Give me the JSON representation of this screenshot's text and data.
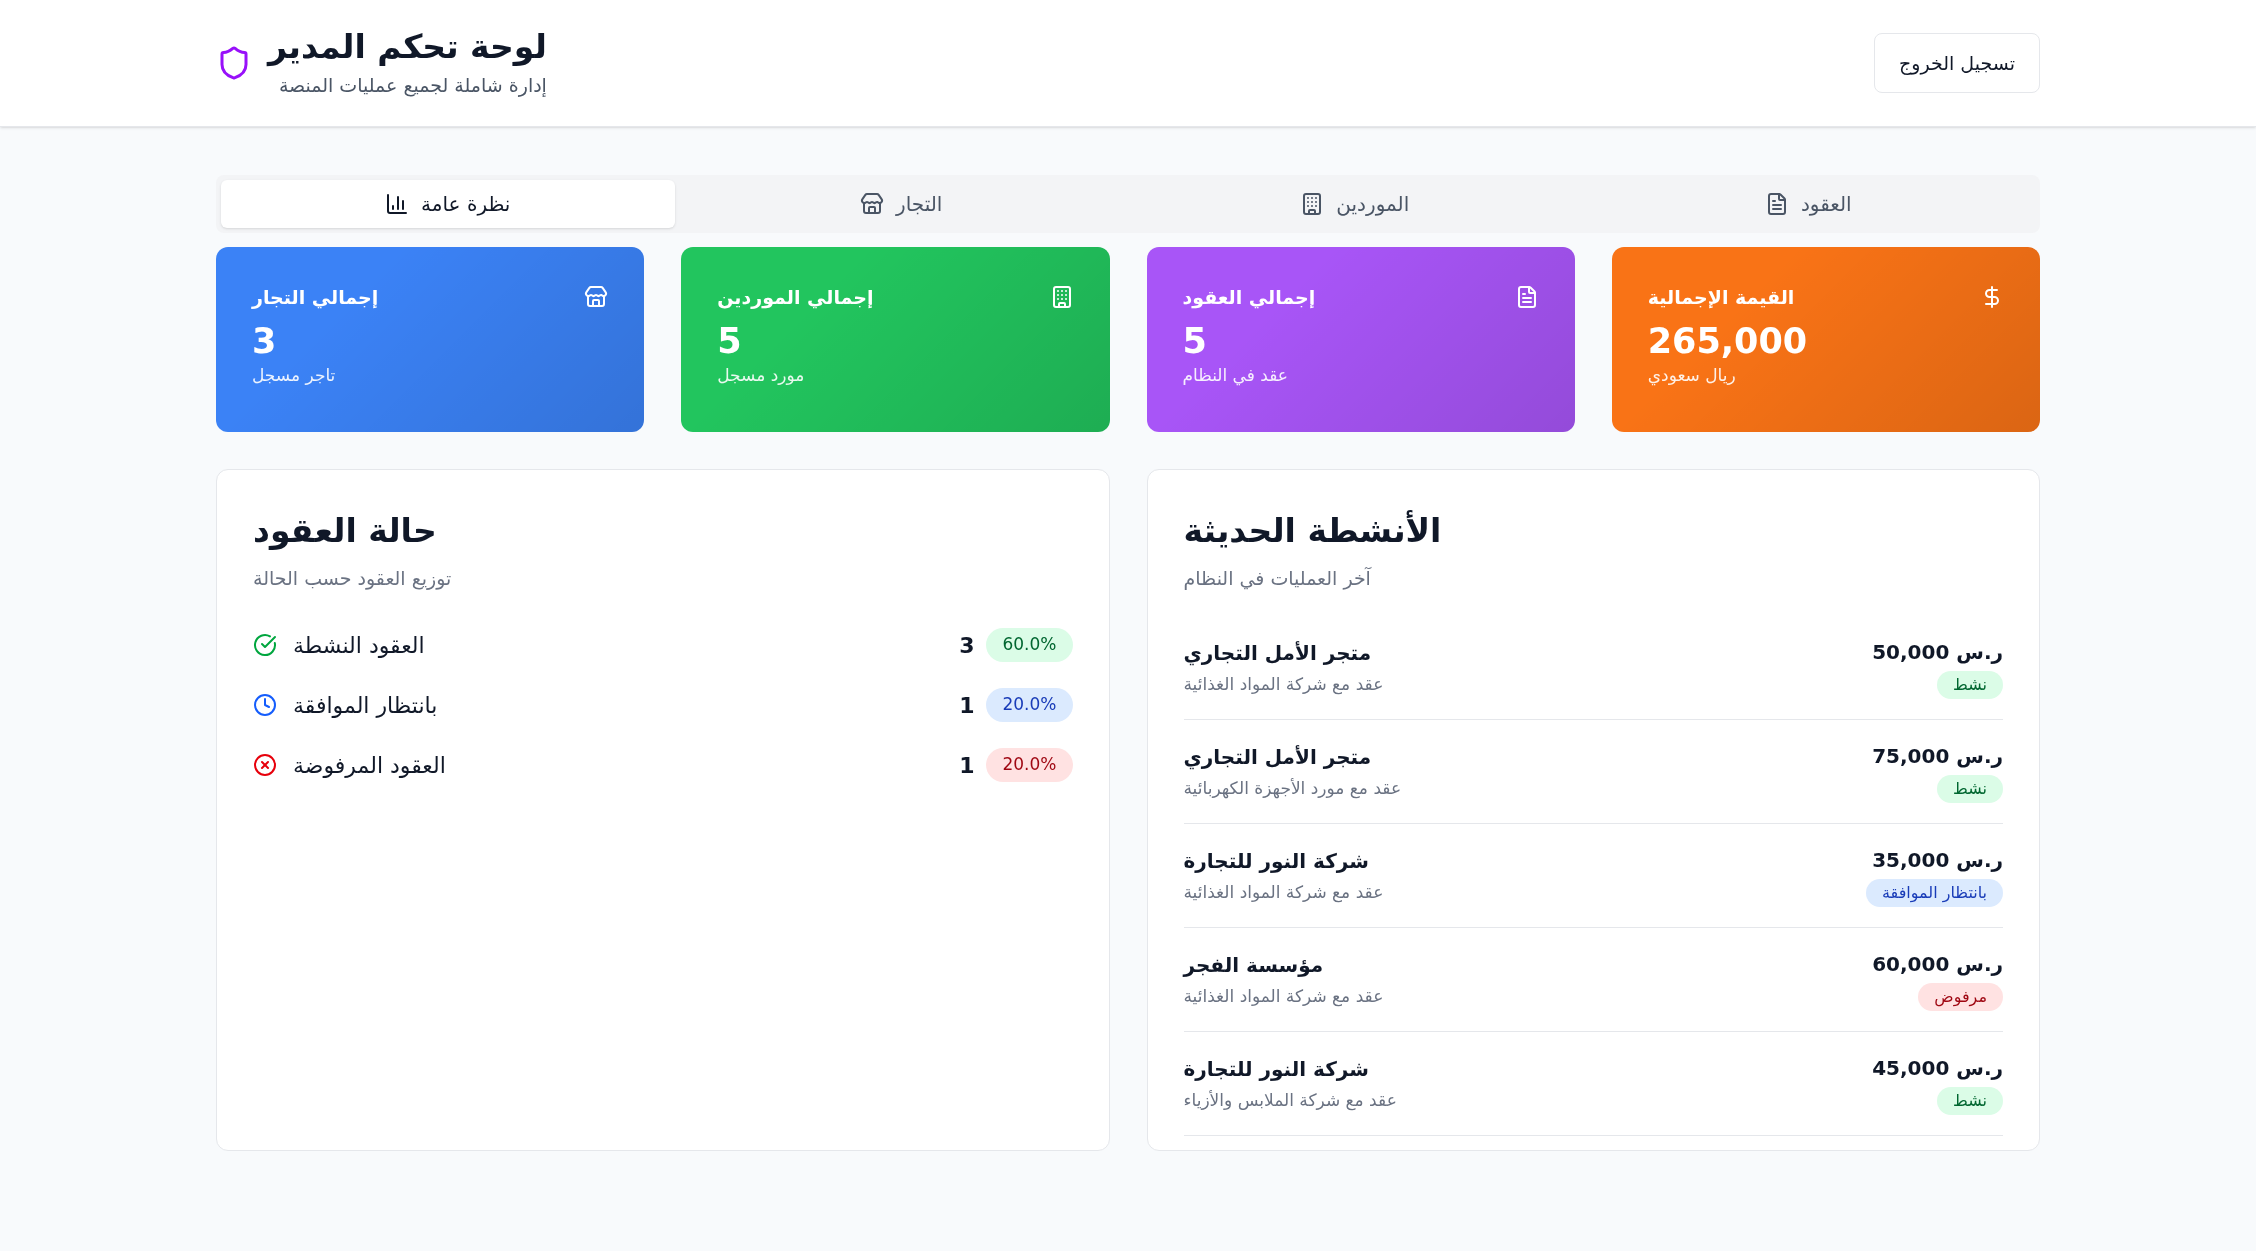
{
  "header": {
    "title": "لوحة تحكم المدير",
    "subtitle": "إدارة شاملة لجميع عمليات المنصة",
    "logout": "تسجيل الخروج"
  },
  "tabs": [
    {
      "label": "العقود",
      "kind": "contracts",
      "selected": false
    },
    {
      "label": "الموردين",
      "kind": "suppliers",
      "selected": false
    },
    {
      "label": "التجار",
      "kind": "merchants",
      "selected": false
    },
    {
      "label": "نظرة عامة",
      "kind": "overview",
      "selected": true
    }
  ],
  "stats": [
    {
      "title": "القيمة الإجمالية",
      "kind": "value",
      "value": "265,000",
      "caption": "ريال سعودي",
      "color": "#f97316"
    },
    {
      "title": "إجمالي العقود",
      "kind": "contracts",
      "value": "5",
      "caption": "عقد في النظام",
      "color": "#a855f7"
    },
    {
      "title": "إجمالي الموردين",
      "kind": "suppliers",
      "value": "5",
      "caption": "مورد مسجل",
      "color": "#22c55e"
    },
    {
      "title": "إجمالي التجار",
      "kind": "merchants",
      "value": "3",
      "caption": "تاجر مسجل",
      "color": "#3b82f6"
    }
  ],
  "recent_activity": {
    "title": "الأنشطة الحديثة",
    "subtitle": "آخر العمليات في النظام",
    "rows": [
      {
        "name": "متجر الأمل التجاري",
        "detail": "عقد مع شركة المواد الغذائية",
        "amount": "50,000 ر.س",
        "kind": "active",
        "status": "نشط"
      },
      {
        "name": "متجر الأمل التجاري",
        "detail": "عقد مع مورد الأجهزة الكهربائية",
        "amount": "75,000 ر.س",
        "kind": "active",
        "status": "نشط"
      },
      {
        "name": "شركة النور للتجارة",
        "detail": "عقد مع شركة المواد الغذائية",
        "amount": "35,000 ر.س",
        "kind": "pending",
        "status": "بانتظار الموافقة"
      },
      {
        "name": "مؤسسة الفجر",
        "detail": "عقد مع شركة المواد الغذائية",
        "amount": "60,000 ر.س",
        "kind": "rejected",
        "status": "مرفوض"
      },
      {
        "name": "شركة النور للتجارة",
        "detail": "عقد مع شركة الملابس والأزياء",
        "amount": "45,000 ر.س",
        "kind": "active",
        "status": "نشط"
      }
    ]
  },
  "contract_status": {
    "title": "حالة العقود",
    "subtitle": "توزيع العقود حسب الحالة",
    "rows": [
      {
        "label": "العقود النشطة",
        "kind": "active",
        "count": "3",
        "percent": "60.0%"
      },
      {
        "label": "بانتظار الموافقة",
        "kind": "pending",
        "count": "1",
        "percent": "20.0%"
      },
      {
        "label": "العقود المرفوضة",
        "kind": "rejected",
        "count": "1",
        "percent": "20.0%"
      }
    ]
  }
}
